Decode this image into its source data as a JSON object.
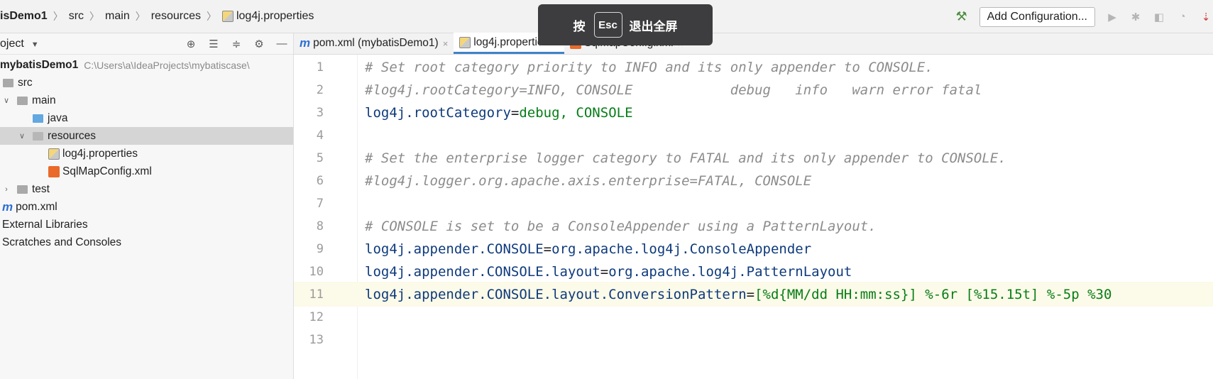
{
  "breadcrumbs": [
    "isDemo1",
    "src",
    "main",
    "resources",
    "log4j.properties"
  ],
  "toolbar": {
    "add_configuration": "Add Configuration..."
  },
  "fullscreen_toast": {
    "prefix": "按",
    "key": "Esc",
    "suffix": "退出全屏"
  },
  "project_panel": {
    "title": "oject",
    "tree": [
      {
        "label": "mybatisDemo1",
        "hint": "C:\\Users\\a\\IdeaProjects\\mybatiscase\\",
        "bold": true,
        "indent": 0
      },
      {
        "label": "src",
        "indent": 0
      },
      {
        "label": "main",
        "indent": 1
      },
      {
        "label": "java",
        "indent": 2
      },
      {
        "label": "resources",
        "indent": 2,
        "selected": true
      },
      {
        "label": "log4j.properties",
        "indent": 3
      },
      {
        "label": "SqlMapConfig.xml",
        "indent": 3
      },
      {
        "label": "test",
        "indent": 1
      },
      {
        "label": "pom.xml",
        "indent": 0
      },
      {
        "label": "External Libraries",
        "indent": 0
      },
      {
        "label": "Scratches and Consoles",
        "indent": 0
      }
    ]
  },
  "tabs": [
    {
      "label": "pom.xml (mybatisDemo1)",
      "active": false
    },
    {
      "label": "log4j.properties",
      "active": true
    },
    {
      "label": "SqlMapConfig.xml",
      "active": false
    }
  ],
  "editor": {
    "lines": [
      {
        "n": "1",
        "comment": "# Set root category priority to INFO and its only appender to CONSOLE."
      },
      {
        "n": "2",
        "comment": "#log4j.rootCategory=INFO, CONSOLE            debug   info   warn error fatal"
      },
      {
        "n": "3",
        "key": "log4j.rootCategory",
        "value": "debug, CONSOLE"
      },
      {
        "n": "4"
      },
      {
        "n": "5",
        "comment": "# Set the enterprise logger category to FATAL and its only appender to CONSOLE."
      },
      {
        "n": "6",
        "comment": "#log4j.logger.org.apache.axis.enterprise=FATAL, CONSOLE"
      },
      {
        "n": "7"
      },
      {
        "n": "8",
        "comment": "# CONSOLE is set to be a ConsoleAppender using a PatternLayout."
      },
      {
        "n": "9",
        "key": "log4j.appender.CONSOLE",
        "value": "org.apache.log4j.ConsoleAppender"
      },
      {
        "n": "10",
        "key": "log4j.appender.CONSOLE.layout",
        "value": "org.apache.log4j.PatternLayout"
      },
      {
        "n": "11",
        "key": "log4j.appender.CONSOLE.layout.ConversionPattern",
        "value": "[%d{MM/dd HH:mm:ss}] %-6r [%15.15t] %-5p %30",
        "current": true
      },
      {
        "n": "12"
      },
      {
        "n": "13"
      }
    ]
  }
}
